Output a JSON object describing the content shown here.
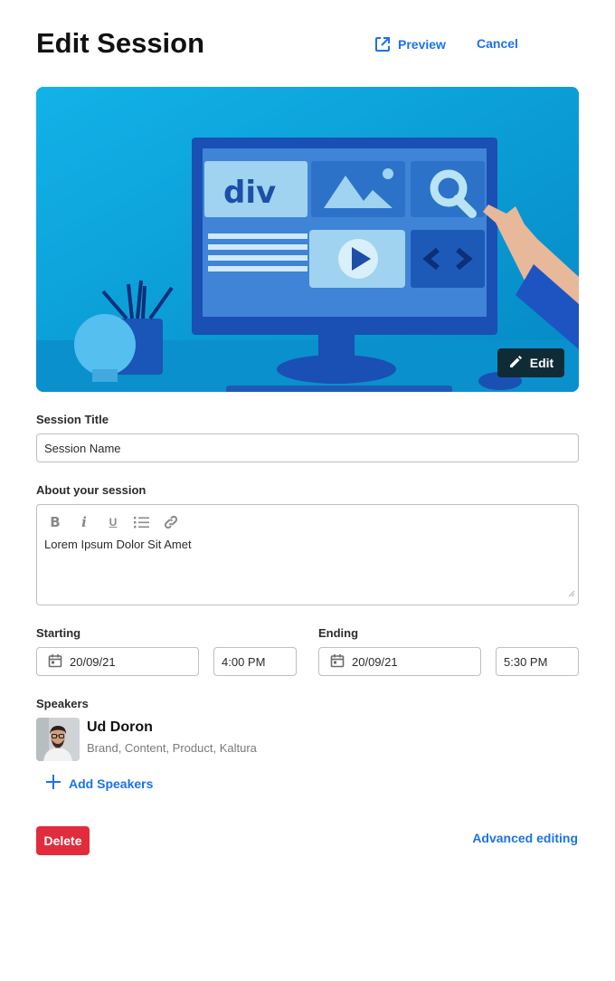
{
  "header": {
    "title": "Edit Session",
    "preview_label": "Preview",
    "cancel_label": "Cancel"
  },
  "hero": {
    "edit_label": "Edit",
    "screen_text": "div"
  },
  "session_title": {
    "label": "Session Title",
    "value": "Session Name"
  },
  "about": {
    "label": "About your session",
    "toolbar": [
      "bold",
      "italic",
      "underline",
      "bulleted-list",
      "link"
    ],
    "toolbar_glyphs": {
      "bold": "B",
      "italic": "i",
      "underline": "U"
    },
    "text": "Lorem Ipsum Dolor Sit Amet"
  },
  "starting": {
    "label": "Starting",
    "date": "20/09/21",
    "time": "4:00 PM"
  },
  "ending": {
    "label": "Ending",
    "date": "20/09/21",
    "time": "5:30 PM"
  },
  "speakers": {
    "label": "Speakers",
    "items": [
      {
        "name": "Ud Doron",
        "role": "Brand, Content, Product, Kaltura"
      }
    ],
    "add_label": "Add Speakers"
  },
  "footer": {
    "delete_label": "Delete",
    "advanced_label": "Advanced editing"
  },
  "colors": {
    "accent": "#1a73e8",
    "danger": "#e12c3e",
    "edit_button_bg": "#0f2b36"
  }
}
